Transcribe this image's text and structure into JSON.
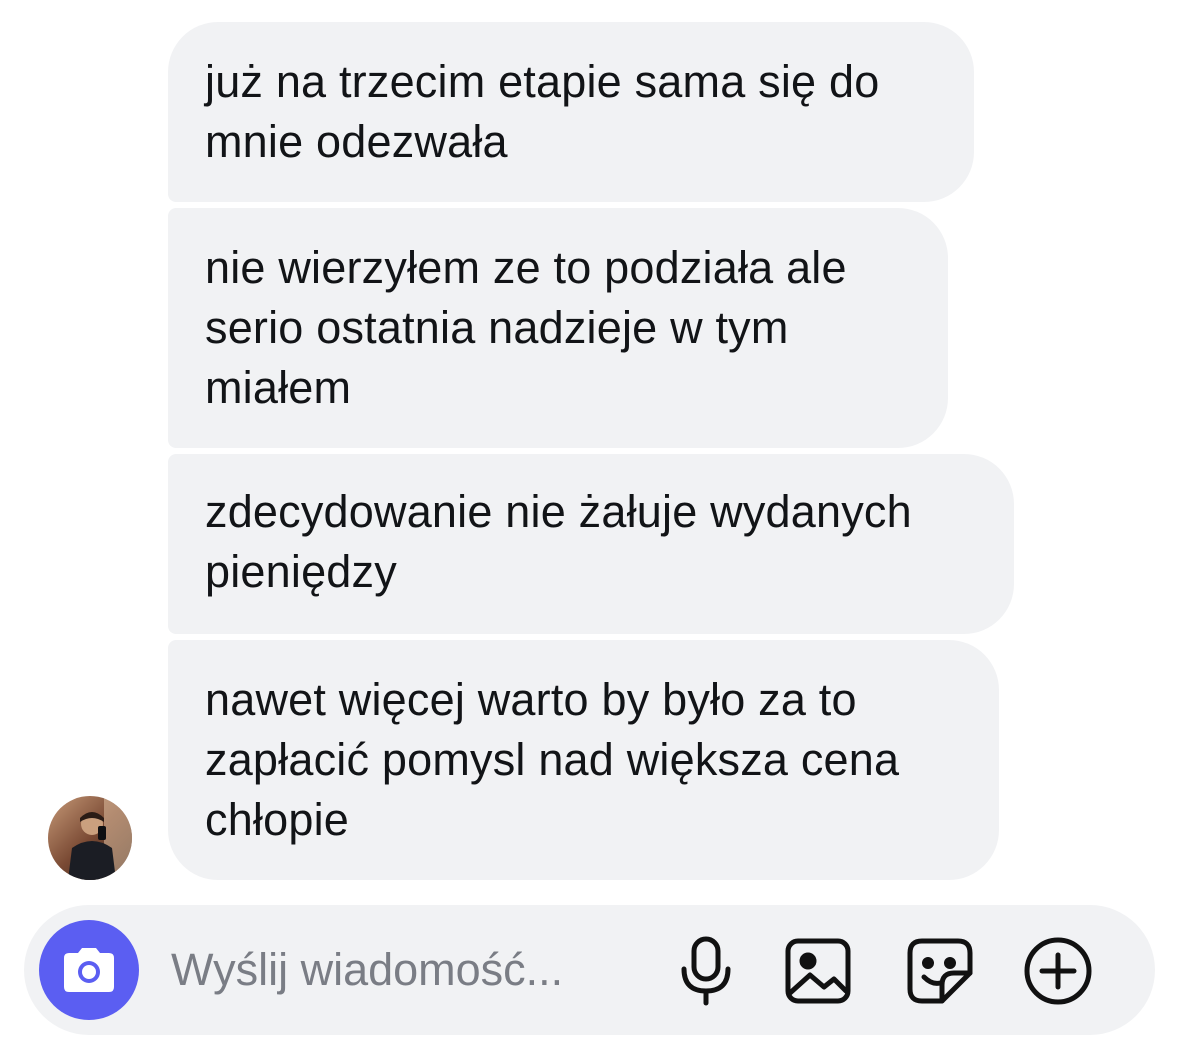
{
  "messages": [
    {
      "lines": [
        "już na trzecim etapie sama się do",
        "mnie odezwała"
      ]
    },
    {
      "lines": [
        "nie wierzyłem ze to podziała ale",
        "serio ostatnia nadzieje w tym",
        "miałem"
      ]
    },
    {
      "lines": [
        "zdecydowanie nie żałuje wydanych",
        "pieniędzy"
      ]
    },
    {
      "lines": [
        "nawet więcej warto by było za to",
        "zapłacić pomysl nad większa cena",
        "chłopie"
      ]
    }
  ],
  "composer": {
    "placeholder": "Wyślij wiadomość...",
    "icons": [
      "camera-icon",
      "microphone-icon",
      "image-icon",
      "sticker-icon",
      "plus-circle-icon"
    ]
  },
  "colors": {
    "bubble": "#f1f2f4",
    "text": "#121417",
    "accent": "#5b5ef2",
    "placeholder": "#7a7d85"
  }
}
